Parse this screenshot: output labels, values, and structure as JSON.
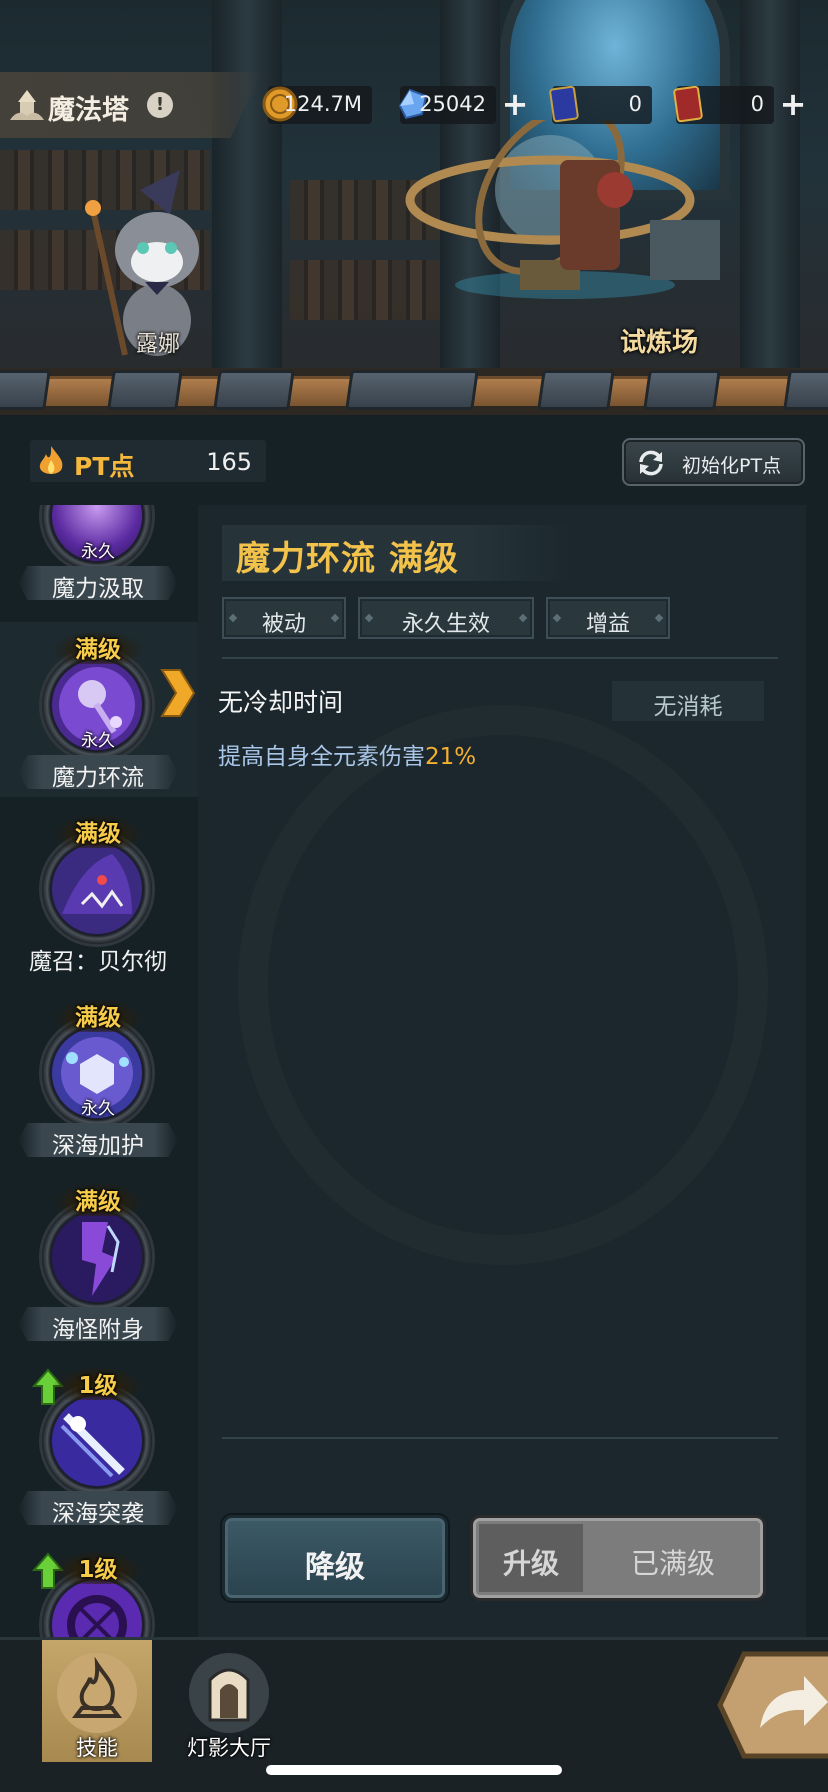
{
  "header": {
    "location_title": "魔法塔",
    "info_icon": "!",
    "character_name": "露娜",
    "area_label": "试炼场"
  },
  "resources": [
    {
      "icon": "gold-coin-icon",
      "value": "124.7M",
      "has_plus": false
    },
    {
      "icon": "crystal-icon",
      "value": "25042",
      "has_plus": true
    },
    {
      "icon": "blue-ticket-icon",
      "value": "0",
      "has_plus": false
    },
    {
      "icon": "gold-ticket-icon",
      "value": "0",
      "has_plus": true
    }
  ],
  "pt": {
    "label": "PT点",
    "value": "165",
    "reset_label": "初始化PT点"
  },
  "skills": [
    {
      "name": "魔力汲取",
      "badge": "",
      "perm": "永久",
      "selected": false,
      "up": false
    },
    {
      "name": "魔力环流",
      "badge": "满级",
      "perm": "永久",
      "selected": true,
      "up": false
    },
    {
      "name": "魔召：贝尔彻",
      "badge": "满级",
      "perm": "",
      "selected": false,
      "up": false
    },
    {
      "name": "深海加护",
      "badge": "满级",
      "perm": "永久",
      "selected": false,
      "up": false
    },
    {
      "name": "海怪附身",
      "badge": "满级",
      "perm": "",
      "selected": false,
      "up": false
    },
    {
      "name": "深海突袭",
      "badge": "1级",
      "perm": "",
      "selected": false,
      "up": true
    },
    {
      "name": "",
      "badge": "1级",
      "perm": "",
      "selected": false,
      "up": true
    }
  ],
  "detail": {
    "title": "魔力环流 满级",
    "tags": [
      "被动",
      "永久生效",
      "增益"
    ],
    "cooldown": "无冷却时间",
    "cost": "无消耗",
    "desc_prefix": "提高自身全元素伤害",
    "desc_value": "21%",
    "btn_downgrade": "降级",
    "btn_upgrade": "升级",
    "btn_maxed": "已满级"
  },
  "nav": [
    {
      "label": "技能",
      "icon": "skill-flame-icon",
      "active": true
    },
    {
      "label": "灯影大厅",
      "icon": "lamp-hall-icon",
      "active": false
    }
  ],
  "colors": {
    "accent": "#f3c24a",
    "highlight": "#f3b030",
    "desc": "#a9c6e8",
    "panel": "#1b272c"
  }
}
